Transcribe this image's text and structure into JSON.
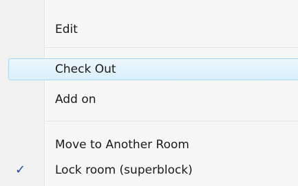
{
  "menu": {
    "items": [
      {
        "label": "Edit"
      },
      {
        "label": "Check Out"
      },
      {
        "label": "Add on"
      },
      {
        "label": "Move to Another Room"
      },
      {
        "label": "Lock room (superblock)",
        "checked": true
      }
    ],
    "check_glyph": "✓"
  },
  "colors": {
    "highlight_border": "#a8d8f0",
    "check": "#1b4f9c"
  }
}
